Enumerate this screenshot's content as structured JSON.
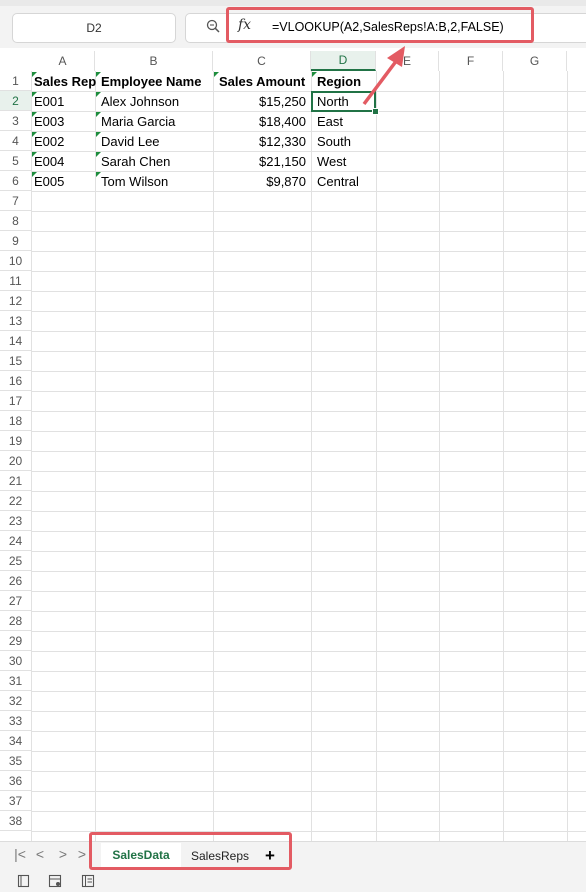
{
  "formula_bar": {
    "name_box": "D2",
    "fx_symbol": "fx",
    "formula": "=VLOOKUP(A2,SalesReps!A:B,2,FALSE)"
  },
  "columns": [
    "A",
    "B",
    "C",
    "D",
    "E",
    "F",
    "G"
  ],
  "active_column": "D",
  "active_row": "2",
  "rows": [
    "1",
    "2",
    "3",
    "4",
    "5",
    "6",
    "7",
    "8",
    "9",
    "10",
    "11",
    "12",
    "13",
    "14",
    "15",
    "16",
    "17",
    "18",
    "19",
    "20",
    "21",
    "22",
    "23",
    "24",
    "25",
    "26",
    "27",
    "28",
    "29",
    "30",
    "31",
    "32",
    "33",
    "34",
    "35",
    "36",
    "37",
    "38"
  ],
  "header_row": {
    "a": "Sales Rep",
    "b": "Employee Name",
    "c": "Sales Amount",
    "d": "Region"
  },
  "data_rows": [
    {
      "a": "E001",
      "b": "Alex Johnson",
      "c": "$15,250",
      "d": "North"
    },
    {
      "a": "E003",
      "b": "Maria Garcia",
      "c": "$18,400",
      "d": "East"
    },
    {
      "a": "E002",
      "b": "David Lee",
      "c": "$12,330",
      "d": "South"
    },
    {
      "a": "E004",
      "b": "Sarah Chen",
      "c": "$21,150",
      "d": "West"
    },
    {
      "a": "E005",
      "b": "Tom Wilson",
      "c": "$9,870",
      "d": "Central"
    }
  ],
  "sheet_tabs": [
    {
      "label": "SalesData",
      "active": true
    },
    {
      "label": "SalesReps",
      "active": false
    }
  ],
  "add_sheet_label": "+",
  "nav_arrows": [
    "|<",
    "<",
    ">",
    ">"
  ],
  "colors": {
    "accent": "#217346",
    "highlight": "#e35b63",
    "flag": "#1e8e3e"
  },
  "icons": {
    "zoom": "zoom-formula-icon",
    "status": [
      "sheet-view-icon",
      "accessibility-icon",
      "page-layout-icon"
    ]
  }
}
